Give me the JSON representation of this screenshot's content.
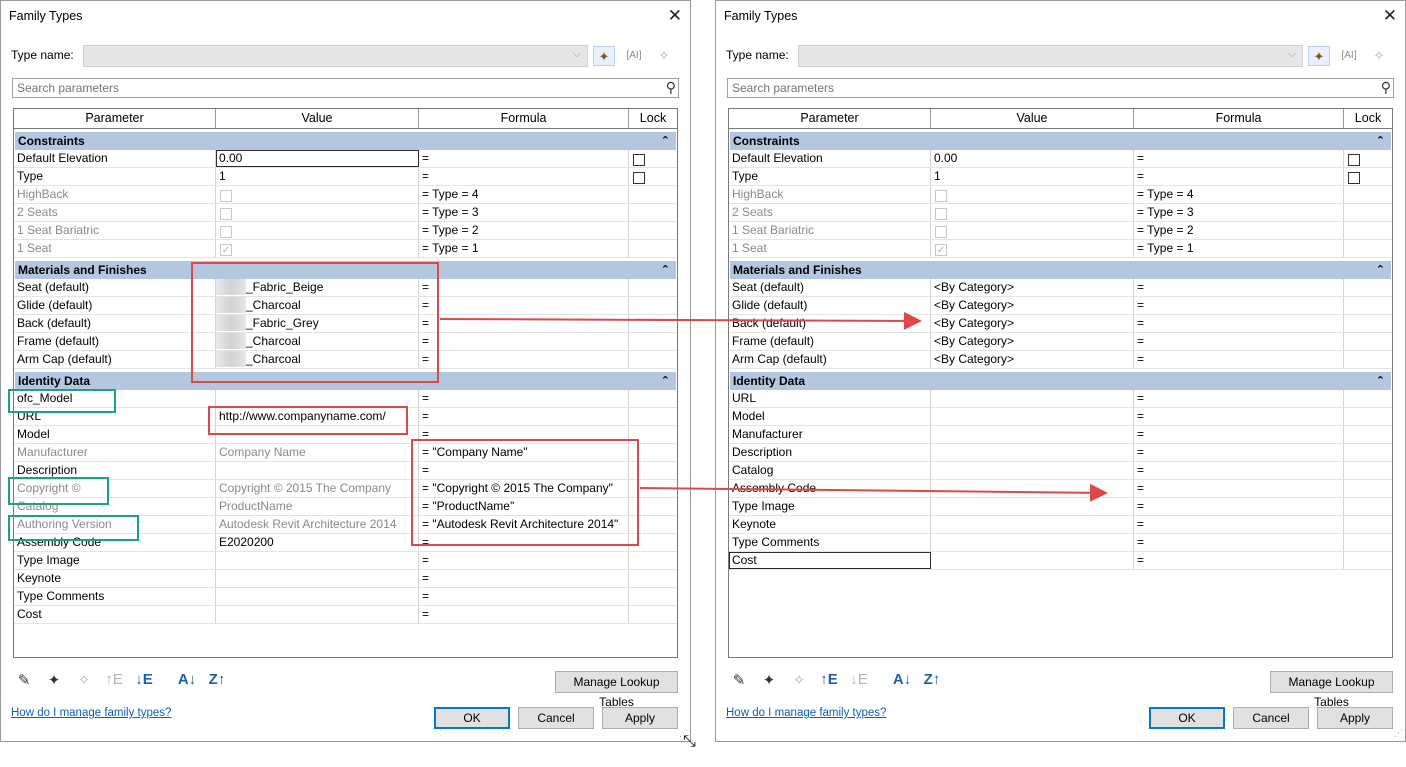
{
  "dialogs": [
    {
      "title": "Family Types",
      "type_name_label": "Type name:",
      "type_name_value": "",
      "search_placeholder": "Search parameters",
      "columns": [
        "Parameter",
        "Value",
        "Formula",
        "Lock"
      ],
      "groups": [
        {
          "label": "Constraints",
          "rows": [
            {
              "name": "Default Elevation",
              "value": "0.00",
              "formula": "=",
              "lock": "box",
              "editing": true
            },
            {
              "name": "Type",
              "value": "1",
              "formula": "=",
              "lock": "box"
            },
            {
              "name": "HighBack",
              "value_check": "empty",
              "formula": "= Type = 4",
              "dim": true
            },
            {
              "name": "2 Seats",
              "value_check": "empty",
              "formula": "= Type = 3",
              "dim": true
            },
            {
              "name": "1 Seat Bariatric",
              "value_check": "empty",
              "formula": "= Type = 2",
              "dim": true
            },
            {
              "name": "1 Seat",
              "value_check": "checked",
              "formula": "= Type = 1",
              "dim": true
            }
          ]
        },
        {
          "label": "Materials and Finishes",
          "rows": [
            {
              "name": "Seat (default)",
              "value": "_Fabric_Beige",
              "blur": true,
              "formula": "="
            },
            {
              "name": "Glide (default)",
              "value": "_Charcoal",
              "blur": true,
              "formula": "="
            },
            {
              "name": "Back (default)",
              "value": "_Fabric_Grey",
              "blur": true,
              "formula": "="
            },
            {
              "name": "Frame (default)",
              "value": "_Charcoal",
              "blur": true,
              "formula": "="
            },
            {
              "name": "Arm Cap (default)",
              "value": "_Charcoal",
              "blur": true,
              "formula": "="
            }
          ]
        },
        {
          "label": "Identity Data",
          "rows": [
            {
              "name": "ofc_Model",
              "value": "",
              "formula": "="
            },
            {
              "name": "URL",
              "value": "http://www.companyname.com/",
              "formula": "="
            },
            {
              "name": "Model",
              "value": "",
              "formula": "="
            },
            {
              "name": "Manufacturer",
              "value": "Company Name",
              "formula": "= \"Company Name\"",
              "dim": true
            },
            {
              "name": "Description",
              "value": "",
              "formula": "="
            },
            {
              "name": "Copyright ©",
              "value": "Copyright © 2015 The Company",
              "formula": "= \"Copyright © 2015 The Company\"",
              "dim": true
            },
            {
              "name": "Catalog",
              "value": "ProductName",
              "formula": "= \"ProductName\"",
              "dim": true
            },
            {
              "name": "Authoring Version",
              "value": "Autodesk Revit Architecture 2014",
              "formula": "= \"Autodesk Revit Architecture 2014\"",
              "dim": true
            },
            {
              "name": "Assembly Code",
              "value": "E2020200",
              "formula": "="
            },
            {
              "name": "Type Image",
              "value": "",
              "formula": "="
            },
            {
              "name": "Keynote",
              "value": "",
              "formula": "="
            },
            {
              "name": "Type Comments",
              "value": "",
              "formula": "="
            },
            {
              "name": "Cost",
              "value": "",
              "formula": "="
            }
          ]
        }
      ],
      "manage_lookup_label": "Manage Lookup Tables",
      "help_link": "How do I manage family types?",
      "ok_label": "OK",
      "cancel_label": "Cancel",
      "apply_label": "Apply"
    },
    {
      "title": "Family Types",
      "type_name_label": "Type name:",
      "type_name_value": "",
      "search_placeholder": "Search parameters",
      "columns": [
        "Parameter",
        "Value",
        "Formula",
        "Lock"
      ],
      "groups": [
        {
          "label": "Constraints",
          "rows": [
            {
              "name": "Default Elevation",
              "value": "0.00",
              "formula": "=",
              "lock": "box"
            },
            {
              "name": "Type",
              "value": "1",
              "formula": "=",
              "lock": "box"
            },
            {
              "name": "HighBack",
              "value_check": "empty",
              "formula": "= Type = 4",
              "dim": true
            },
            {
              "name": "2 Seats",
              "value_check": "empty",
              "formula": "= Type = 3",
              "dim": true
            },
            {
              "name": "1 Seat Bariatric",
              "value_check": "empty",
              "formula": "= Type = 2",
              "dim": true
            },
            {
              "name": "1 Seat",
              "value_check": "checked",
              "formula": "= Type = 1",
              "dim": true
            }
          ]
        },
        {
          "label": "Materials and Finishes",
          "rows": [
            {
              "name": "Seat (default)",
              "value": "<By Category>",
              "formula": "="
            },
            {
              "name": "Glide (default)",
              "value": "<By Category>",
              "formula": "="
            },
            {
              "name": "Back (default)",
              "value": "<By Category>",
              "formula": "="
            },
            {
              "name": "Frame (default)",
              "value": "<By Category>",
              "formula": "="
            },
            {
              "name": "Arm Cap (default)",
              "value": "<By Category>",
              "formula": "="
            }
          ]
        },
        {
          "label": "Identity Data",
          "rows": [
            {
              "name": "URL",
              "value": "",
              "formula": "="
            },
            {
              "name": "Model",
              "value": "",
              "formula": "="
            },
            {
              "name": "Manufacturer",
              "value": "",
              "formula": "="
            },
            {
              "name": "Description",
              "value": "",
              "formula": "="
            },
            {
              "name": "Catalog",
              "value": "",
              "formula": "="
            },
            {
              "name": "Assembly Code",
              "value": "",
              "formula": "="
            },
            {
              "name": "Type Image",
              "value": "",
              "formula": "="
            },
            {
              "name": "Keynote",
              "value": "",
              "formula": "="
            },
            {
              "name": "Type Comments",
              "value": "",
              "formula": "="
            },
            {
              "name": "Cost",
              "value": "",
              "formula": "=",
              "editing_name": true
            }
          ]
        }
      ],
      "manage_lookup_label": "Manage Lookup Tables",
      "help_link": "How do I manage family types?",
      "ok_label": "OK",
      "cancel_label": "Cancel",
      "apply_label": "Apply"
    }
  ],
  "icons": {
    "close": "close-icon",
    "new_type": "new-type-icon",
    "rename_type": "rename-type-icon",
    "delete_type": "delete-type-icon",
    "search": "search-icon",
    "collapse": "collapse-chevron-icon",
    "edit_param": "pencil-icon",
    "new_param": "new-parameter-icon",
    "delete_param": "delete-parameter-icon",
    "move_up": "move-up-icon",
    "move_down": "move-down-icon",
    "sort_asc": "sort-ascending-icon",
    "sort_desc": "sort-descending-icon"
  },
  "annotation_colors": {
    "red": "#e04848",
    "green": "#1aa383"
  }
}
